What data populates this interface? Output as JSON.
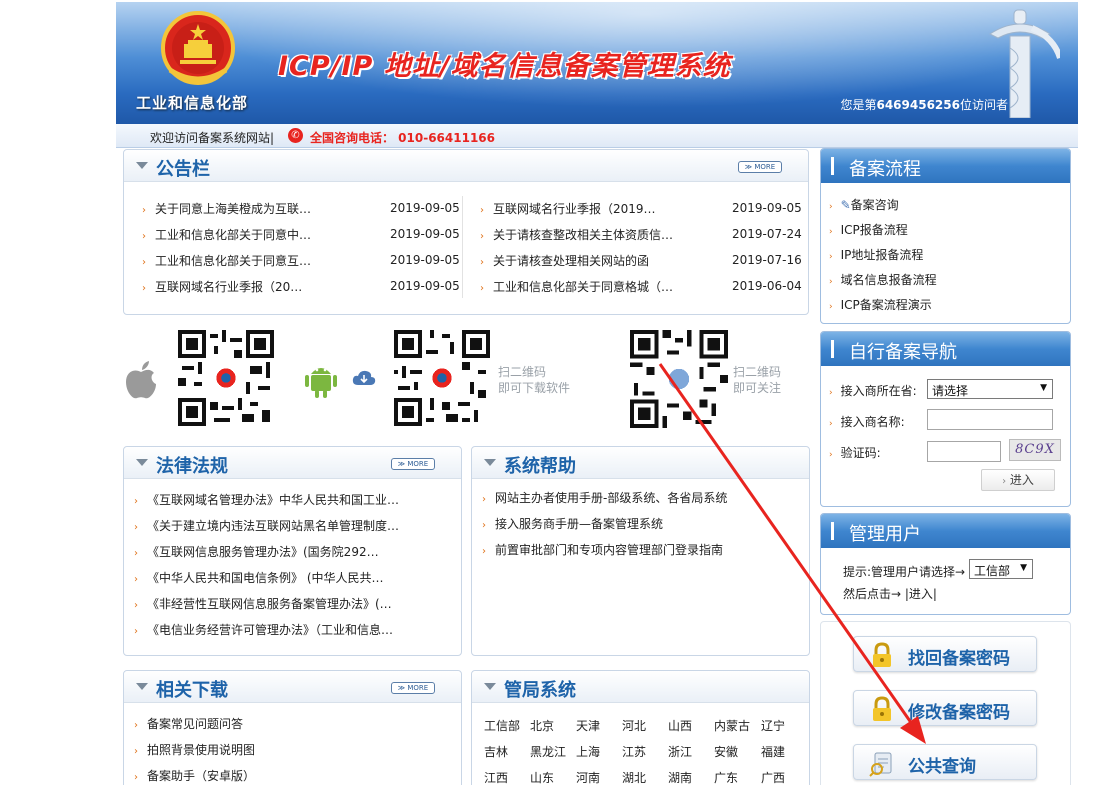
{
  "header": {
    "ministry": "工业和信息化部",
    "system_title": "ICP/IP 地址/域名信息备案管理系统",
    "visitor_prefix": "您是第",
    "visitor_count": "6469456256",
    "visitor_suffix": "位访问者",
    "welcome": "欢迎访问备案系统网站|",
    "hotline": "全国咨询电话：  010-66411166"
  },
  "bulletin": {
    "title": "公告栏",
    "more": "≫ MORE",
    "left": [
      {
        "text": "关于同意上海美橙成为互联…",
        "date": "2019-09-05"
      },
      {
        "text": "工业和信息化部关于同意中…",
        "date": "2019-09-05"
      },
      {
        "text": "工业和信息化部关于同意互…",
        "date": "2019-09-05"
      },
      {
        "text": "互联网域名行业季报（20…",
        "date": "2019-09-05"
      }
    ],
    "right": [
      {
        "text": "互联网域名行业季报（2019…",
        "date": "2019-09-05"
      },
      {
        "text": "关于请核查整改相关主体资质信…",
        "date": "2019-07-24"
      },
      {
        "text": "关于请核查处理相关网站的函",
        "date": "2019-07-16"
      },
      {
        "text": "工业和信息化部关于同意格城（…",
        "date": "2019-06-04"
      }
    ]
  },
  "app_download": {
    "scan_line1": "扫二维码",
    "scan_line2": "即可下载软件",
    "follow_line1": "扫二维码",
    "follow_line2": "即可关注"
  },
  "laws": {
    "title": "法律法规",
    "more": "≫ MORE",
    "items": [
      "《互联网域名管理办法》中华人民共和国工业…",
      "《关于建立境内违法互联网站黑名单管理制度…",
      "《互联网信息服务管理办法》(国务院292…",
      "《中华人民共和国电信条例》 (中华人民共…",
      "《非经营性互联网信息服务备案管理办法》(…",
      "《电信业务经营许可管理办法》（工业和信息…"
    ]
  },
  "help": {
    "title": "系统帮助",
    "items": [
      "网站主办者使用手册-部级系统、各省局系统",
      "接入服务商手册—备案管理系统",
      "前置审批部门和专项内容管理部门登录指南"
    ]
  },
  "downloads": {
    "title": "相关下载",
    "more": "≫ MORE",
    "items": [
      "备案常见问题问答",
      "拍照背景使用说明图",
      "备案助手（安卓版）"
    ]
  },
  "bureau": {
    "title": "管局系统",
    "rows": [
      [
        "工信部",
        "北京",
        "天津",
        "河北",
        "山西",
        "内蒙古",
        "辽宁"
      ],
      [
        "吉林",
        "黑龙江",
        "上海",
        "江苏",
        "浙江",
        "安徽",
        "福建"
      ],
      [
        "江西",
        "山东",
        "河南",
        "湖北",
        "湖南",
        "广东",
        "广西"
      ]
    ]
  },
  "process": {
    "title": "备案流程",
    "items": [
      "备案咨询",
      "ICP报备流程",
      "IP地址报备流程",
      "域名信息报备流程",
      "ICP备案流程演示"
    ]
  },
  "self_nav": {
    "title": "自行备案导航",
    "isp_location_label": "接入商所在省:",
    "isp_location_value": "请选择",
    "isp_name_label": "接入商名称:",
    "captcha_label": "验证码:",
    "captcha_text": "8C9X",
    "enter_button": "进入"
  },
  "admin": {
    "title": "管理用户",
    "hint": "提示:管理用户请选择→",
    "select_value": "工信部",
    "then_click": "然后点击→ |进入|"
  },
  "actions": {
    "retrieve_password": "找回备案密码",
    "change_password": "修改备案密码",
    "public_query": "公共查询"
  },
  "colors": {
    "accent_blue": "#1e63a9",
    "title_red": "#e8241f",
    "bullet_orange": "#e0731b",
    "annotation_arrow": "#e8241f"
  }
}
